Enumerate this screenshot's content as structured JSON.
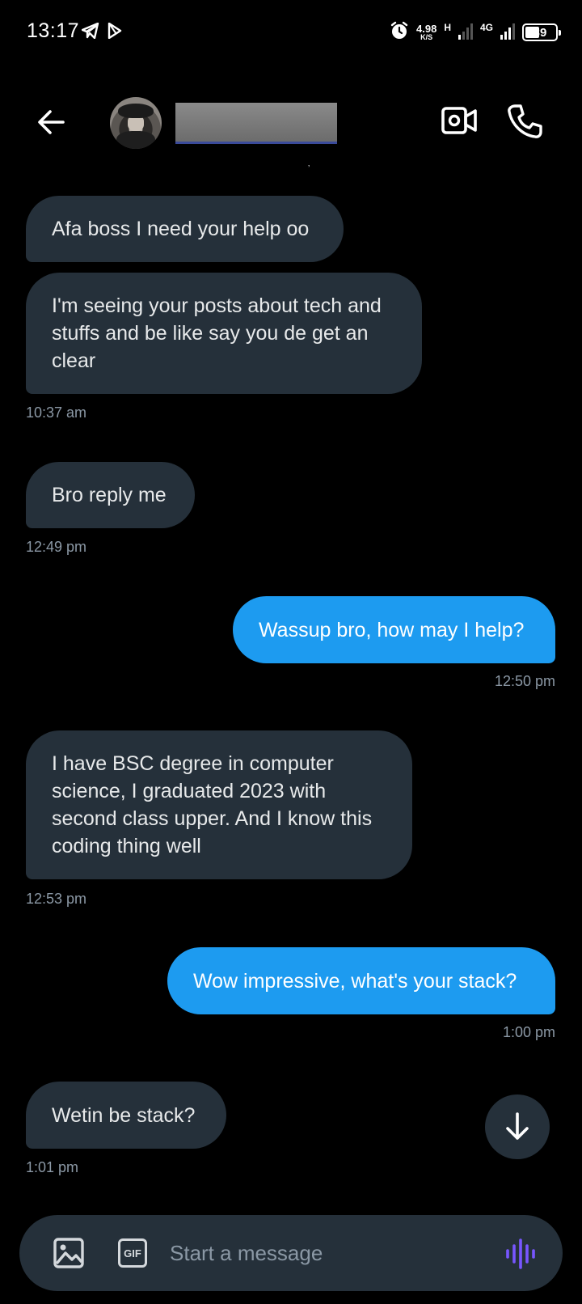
{
  "status_bar": {
    "time": "13:17",
    "speed_value": "4.98",
    "speed_unit": "K/S",
    "network_h": "H",
    "network_4g": "4G",
    "battery_percent": "39"
  },
  "header": {
    "back_icon": "arrow-left-icon",
    "video_icon": "video-camera-icon",
    "call_icon": "phone-icon"
  },
  "messages": [
    {
      "dir": "recv",
      "text": "Afa boss I need your help oo"
    },
    {
      "dir": "recv",
      "text": "I'm seeing your posts about tech and stuffs and be like say you de get an clear",
      "time": "10:37 am"
    },
    {
      "dir": "recv",
      "text": "Bro reply me",
      "time": "12:49 pm"
    },
    {
      "dir": "sent",
      "text": "Wassup bro, how may I help?",
      "time": "12:50 pm"
    },
    {
      "dir": "recv",
      "text": "I have BSC degree in computer science, I graduated 2023 with second class upper. And I know this coding thing well",
      "time": "12:53 pm"
    },
    {
      "dir": "sent",
      "text": "Wow impressive, what's your stack?",
      "time": "1:00 pm"
    },
    {
      "dir": "recv",
      "text": "Wetin be stack?",
      "time": "1:01 pm"
    }
  ],
  "composer": {
    "placeholder": "Start a message",
    "gif_label": "GIF"
  },
  "colors": {
    "background": "#000000",
    "received_bubble": "#25303a",
    "sent_bubble": "#1d9bf0",
    "timestamp": "#8b98a5",
    "voice_accent": "#7856ff"
  }
}
